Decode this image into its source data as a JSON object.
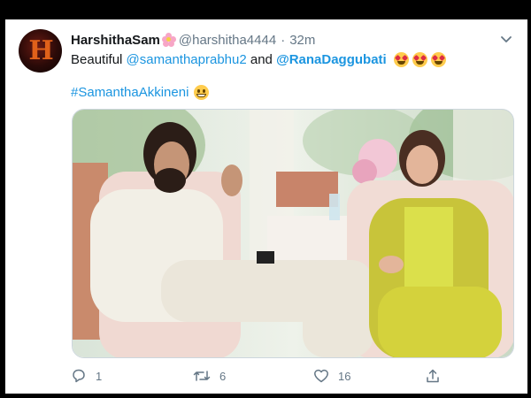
{
  "tweet": {
    "display_name": "HarshithaSam",
    "display_name_emoji": "cherry-blossom-icon",
    "handle": "@harshitha4444",
    "separator": "·",
    "time": "32m",
    "text_prefix": "Beautiful",
    "mention1": "@samanthaprabhu2",
    "text_mid": "and",
    "mention2": "@RanaDaggubati",
    "emojis_line1": [
      "heart-eyes-emoji",
      "heart-eyes-emoji",
      "heart-eyes-emoji"
    ],
    "hashtag": "#SamanthaAkkineni",
    "emoji_line2": "grinning-emoji",
    "media": "photo-of-couple-seated-in-armchairs"
  },
  "actions": {
    "reply_count": "1",
    "retweet_count": "6",
    "like_count": "16"
  },
  "colors": {
    "link": "#1b95e0",
    "muted": "#657786",
    "text": "#14171a"
  }
}
